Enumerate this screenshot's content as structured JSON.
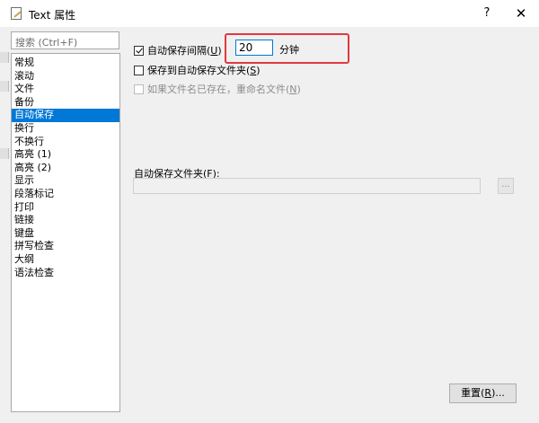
{
  "window": {
    "title": "Text 属性",
    "help_label": "?",
    "close_label": "✕"
  },
  "search": {
    "placeholder": "搜索 (Ctrl+F)"
  },
  "categories": [
    {
      "label": "常规"
    },
    {
      "label": "滚动"
    },
    {
      "label": "文件"
    },
    {
      "label": "备份"
    },
    {
      "label": "自动保存",
      "selected": true
    },
    {
      "label": "换行"
    },
    {
      "label": "不换行"
    },
    {
      "label": "高亮 (1)"
    },
    {
      "label": "高亮 (2)"
    },
    {
      "label": "显示"
    },
    {
      "label": "段落标记"
    },
    {
      "label": "打印"
    },
    {
      "label": "链接"
    },
    {
      "label": "键盘"
    },
    {
      "label": "拼写检查"
    },
    {
      "label": "大纲"
    },
    {
      "label": "语法检查"
    }
  ],
  "autosave": {
    "interval": {
      "label": "自动保存间隔(",
      "key": "U",
      "suffix": ")",
      "checked": true
    },
    "minutes_value": "20",
    "minutes_unit": "分钟",
    "save_to_folder": {
      "label": "保存到自动保存文件夹(",
      "key": "S",
      "suffix": ")",
      "checked": false
    },
    "rename_if_exists": {
      "label": "如果文件名已存在，重命名文件(",
      "key": "N",
      "suffix": ")",
      "checked": false,
      "disabled": true
    },
    "folder_label": {
      "label": "自动保存文件夹(",
      "key": "F",
      "suffix": "):"
    },
    "folder_path": "",
    "browse_label": "..."
  },
  "buttons": {
    "reset": {
      "label": "重置(",
      "key": "R",
      "suffix": ")..."
    }
  },
  "colors": {
    "selection": "#0078d7",
    "highlight_box": "#e0393f"
  }
}
